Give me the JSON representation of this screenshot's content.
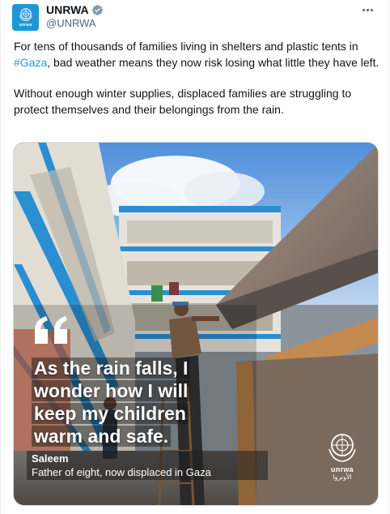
{
  "author": {
    "display_name": "UNRWA",
    "handle": "@UNRWA",
    "avatar_text": "unrwa",
    "verified": true
  },
  "post": {
    "paragraph1_before": "For tens of thousands of families living in shelters and plastic tents in ",
    "hashtag": "#Gaza",
    "paragraph1_after": ", bad weather means they now risk losing what little they have left.",
    "paragraph2": "Without enough winter supplies, displaced families are struggling to protect themselves and their belongings from the rain."
  },
  "media": {
    "quote_line1": "As the rain falls, I",
    "quote_line2": "wonder how I will",
    "quote_line3": "keep my children",
    "quote_line4": "warm and safe.",
    "caption_name": "Saleem",
    "caption_role": "Father of eight, now displaced in Gaza",
    "logo_text": "unrwa",
    "logo_arabic": "الأونروا"
  },
  "colors": {
    "brand_blue": "#1f97d4",
    "link_blue": "#1d9bf0",
    "text": "#0f1419",
    "muted": "#536471"
  },
  "icons": [
    "un-emblem-icon",
    "verified-badge-icon",
    "more-options-icon",
    "quote-mark-icon"
  ]
}
